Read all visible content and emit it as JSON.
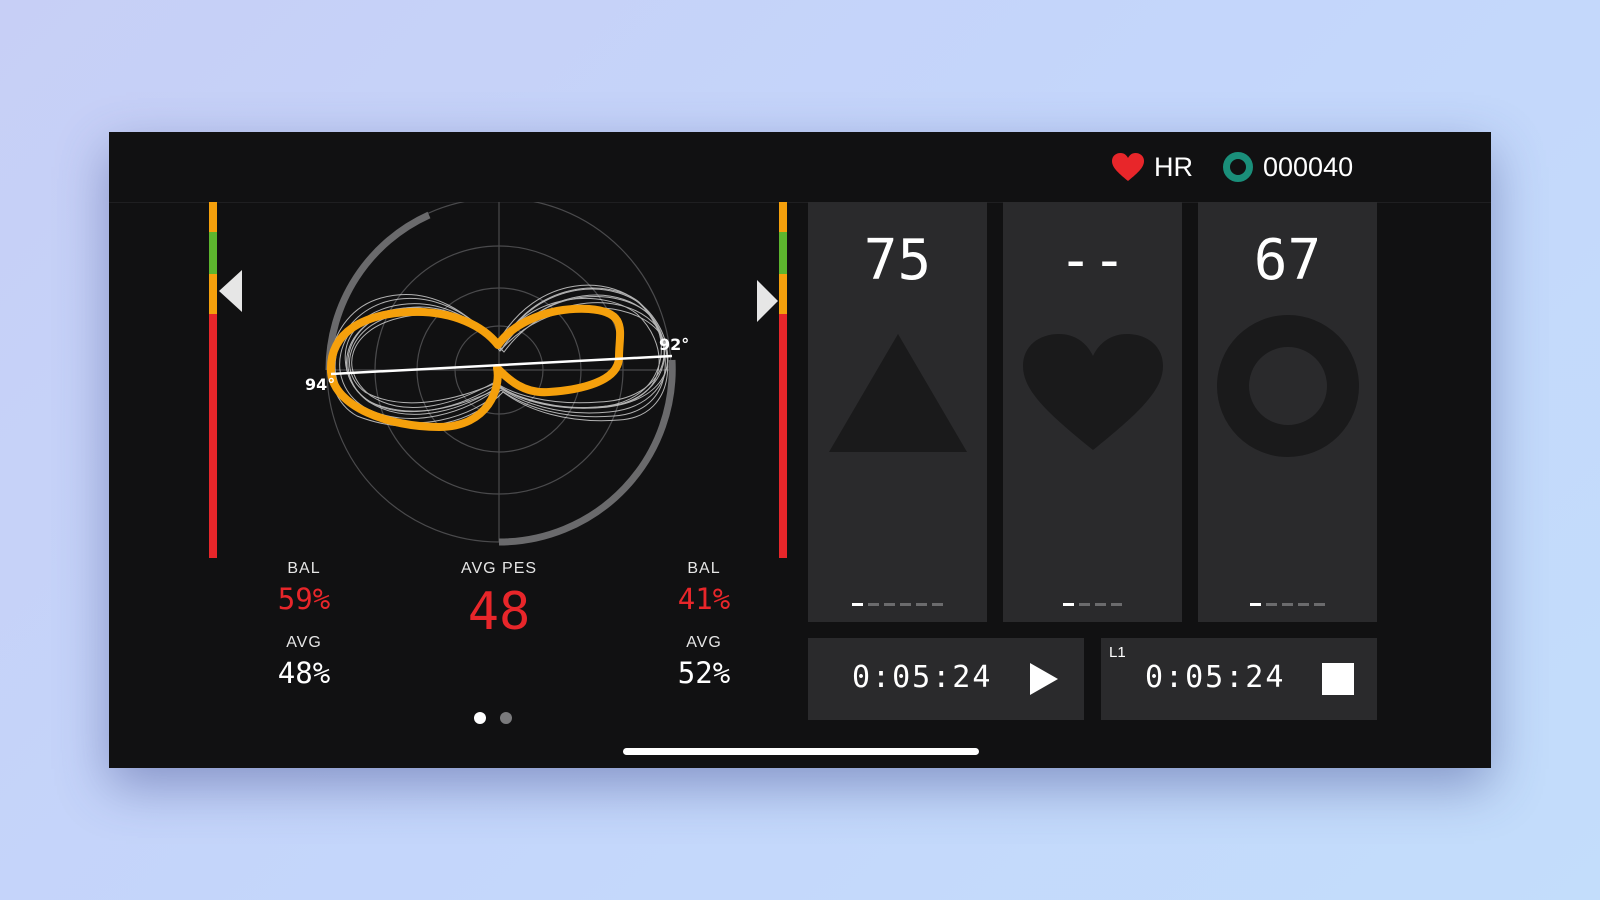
{
  "status_bar": {
    "hr_label": "HR",
    "counter": "000040",
    "heart_color": "#e8262a",
    "ring_color": "#1a8f7a"
  },
  "pedal_chart": {
    "left_angle": "94°",
    "right_angle": "92°",
    "left_bal_label": "BAL",
    "left_bal_value": "59%",
    "left_avg_label": "AVG",
    "left_avg_value": "48%",
    "center_label": "AVG PES",
    "center_value": "48",
    "right_bal_label": "BAL",
    "right_bal_value": "41%",
    "right_avg_label": "AVG",
    "right_avg_value": "52%",
    "accent_color": "#f5a00c",
    "page_count": 2,
    "active_page": 1
  },
  "metric_tiles": [
    {
      "value": "75",
      "icon": "triangle-icon",
      "dash_count": 6
    },
    {
      "value": "--",
      "icon": "heart-icon",
      "dash_count": 4
    },
    {
      "value": "67",
      "icon": "ring-icon",
      "dash_count": 5
    }
  ],
  "timers": {
    "total": {
      "value": "0:05:24",
      "icon": "play-icon"
    },
    "lap": {
      "label": "L1",
      "value": "0:05:24",
      "icon": "stop-icon"
    }
  }
}
